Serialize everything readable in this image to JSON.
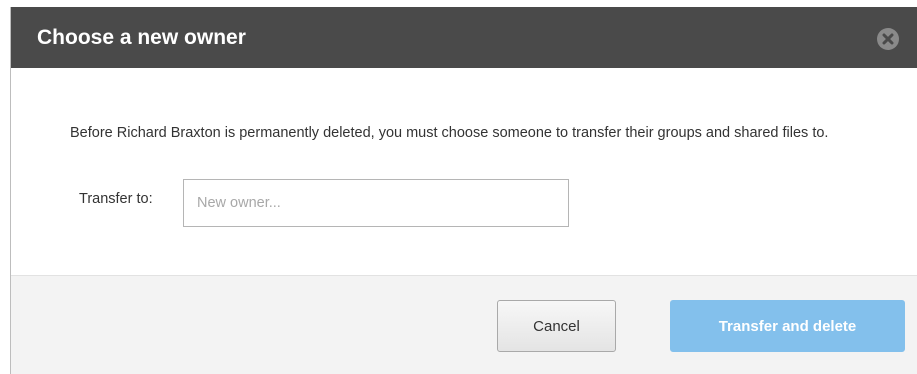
{
  "dialog": {
    "title": "Choose a new owner",
    "close_icon": "close-icon",
    "message": "Before Richard Braxton is permanently deleted, you must choose someone to transfer their groups and shared files to.",
    "transfer_label": "Transfer to:",
    "owner_input": {
      "value": "",
      "placeholder": "New owner..."
    },
    "buttons": {
      "cancel": "Cancel",
      "transfer_and_delete": "Transfer and delete"
    }
  },
  "colors": {
    "header_background": "#4a4a4a",
    "primary_button": "#83c0ec",
    "footer_background": "#f3f3f3"
  }
}
